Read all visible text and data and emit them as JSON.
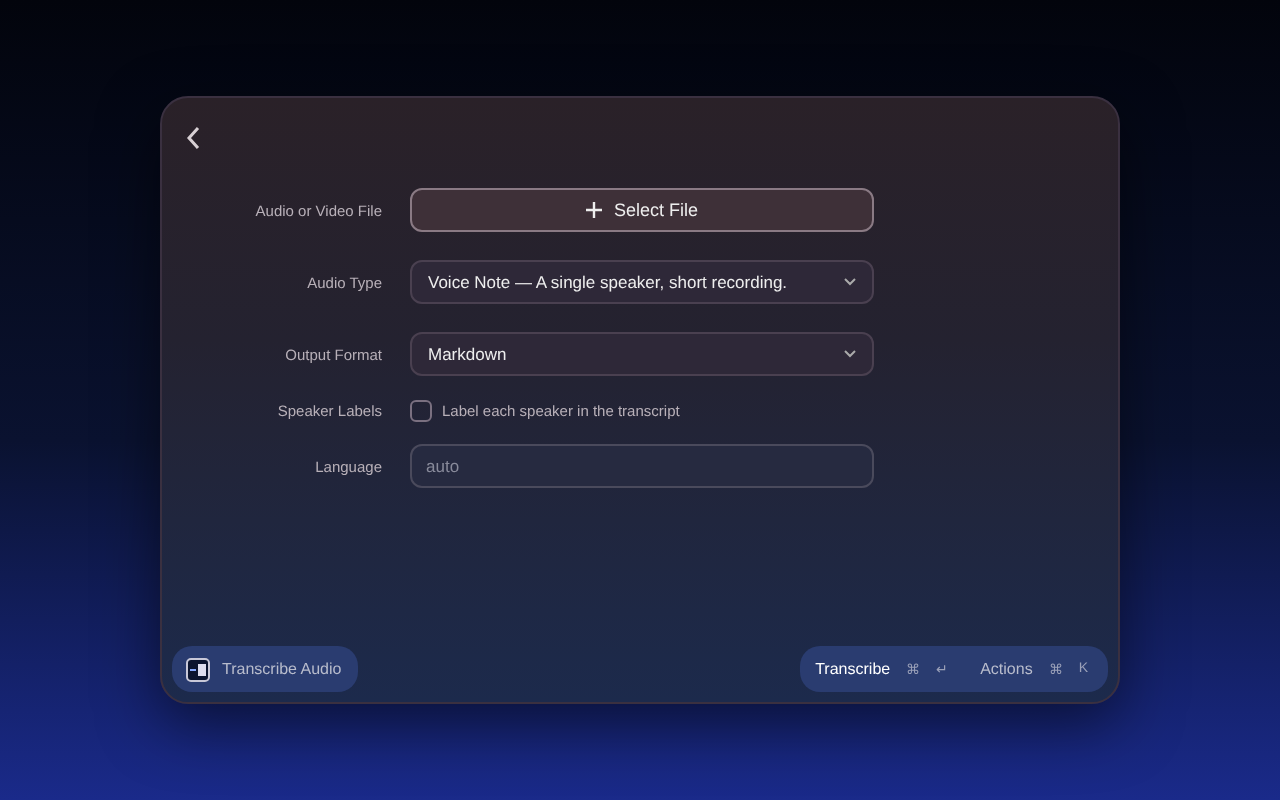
{
  "fields": [
    {
      "label": "Audio or Video File",
      "kind": "file",
      "button": "Select File"
    },
    {
      "label": "Audio Type",
      "kind": "select",
      "value": "Voice Note — A single speaker, short recording."
    },
    {
      "label": "Output Format",
      "kind": "select",
      "value": "Markdown"
    },
    {
      "label": "Speaker Labels",
      "kind": "checkbox",
      "text": "Label each speaker in the transcript",
      "checked": false
    },
    {
      "label": "Language",
      "kind": "text",
      "placeholder": "auto"
    }
  ],
  "footer": {
    "app_name": "Transcribe Audio",
    "actions": [
      {
        "label": "Transcribe",
        "keys": [
          "⌘",
          "↵"
        ]
      },
      {
        "label": "Actions",
        "keys": [
          "⌘",
          "K"
        ]
      }
    ]
  }
}
